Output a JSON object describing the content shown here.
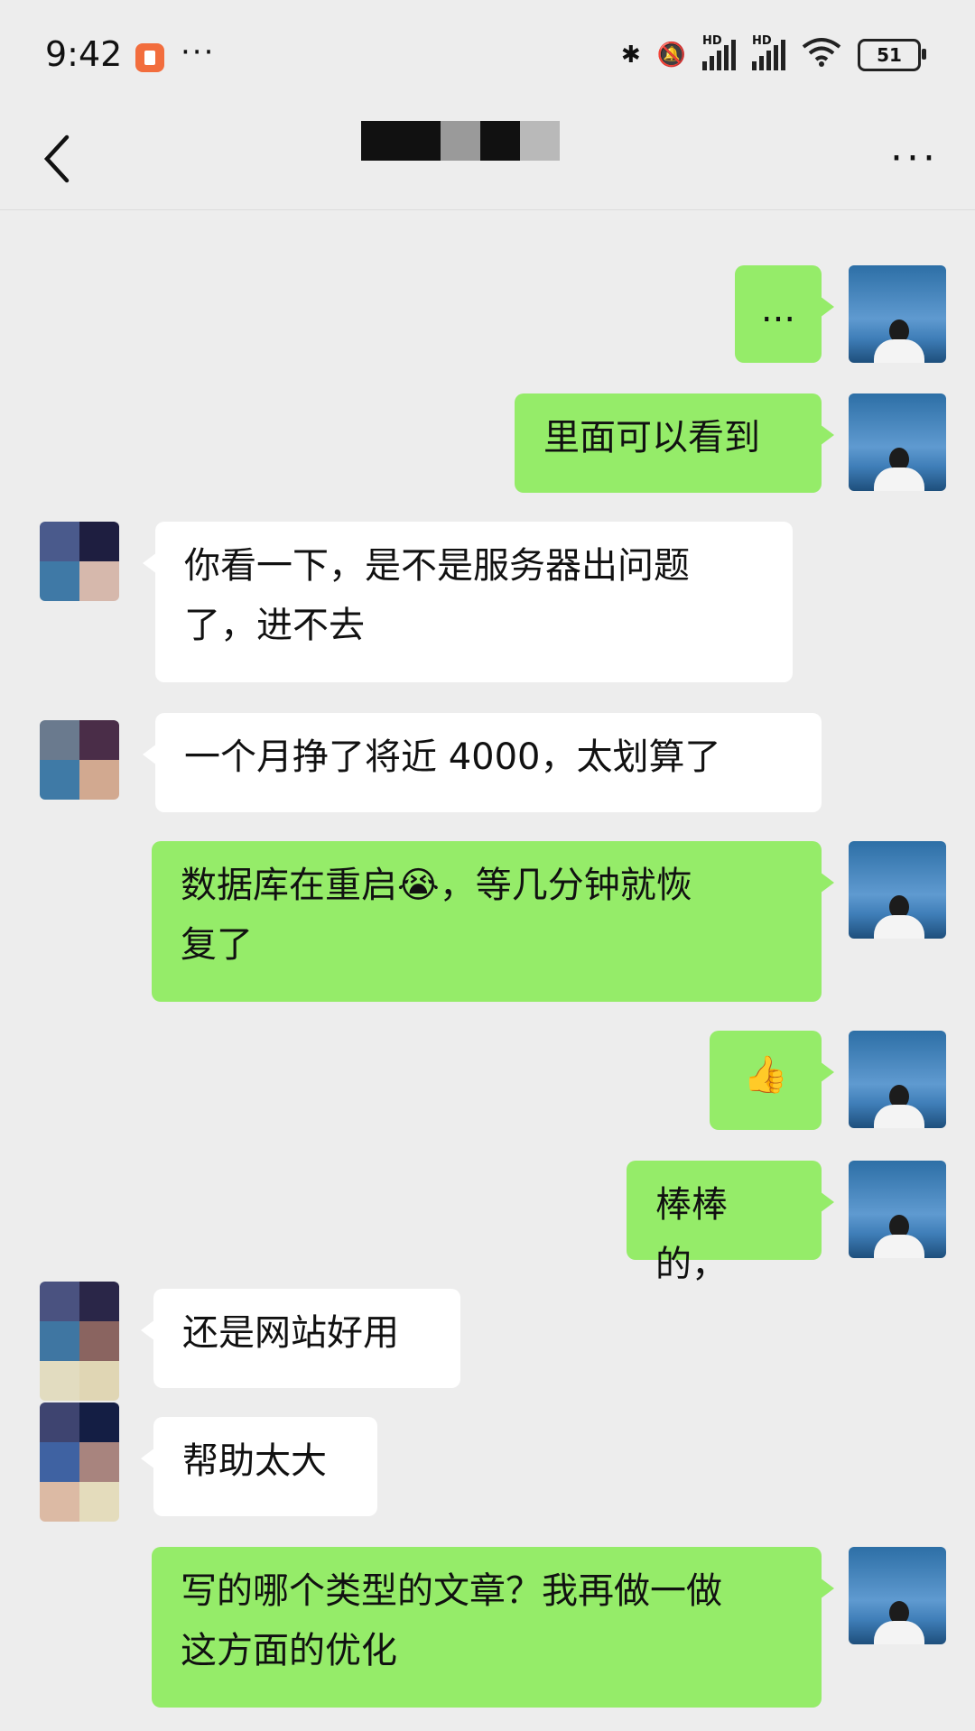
{
  "status": {
    "time": "9:42",
    "dots": "···",
    "battery": "51",
    "network_label": "HD"
  },
  "header": {
    "more": "···"
  },
  "messages": [
    {
      "side": "me",
      "text": "..."
    },
    {
      "side": "me",
      "text": "里面可以看到"
    },
    {
      "side": "other",
      "text": "你看一下，是不是服务器出问题\n了，进不去"
    },
    {
      "side": "other",
      "text": "一个月挣了将近 4000，太划算了"
    },
    {
      "side": "me",
      "text": "数据库在重启😭，等几分钟就恢\n复了"
    },
    {
      "side": "me",
      "text": "👍"
    },
    {
      "side": "me",
      "text": "棒棒的，"
    },
    {
      "side": "other",
      "text": "还是网站好用"
    },
    {
      "side": "other",
      "text": "帮助太大"
    },
    {
      "side": "me",
      "text": "写的哪个类型的文章？我再做一做\n这方面的优化"
    }
  ],
  "colors": {
    "bubble_me": "#95ec69",
    "bubble_other": "#ffffff",
    "background": "#ededed"
  }
}
